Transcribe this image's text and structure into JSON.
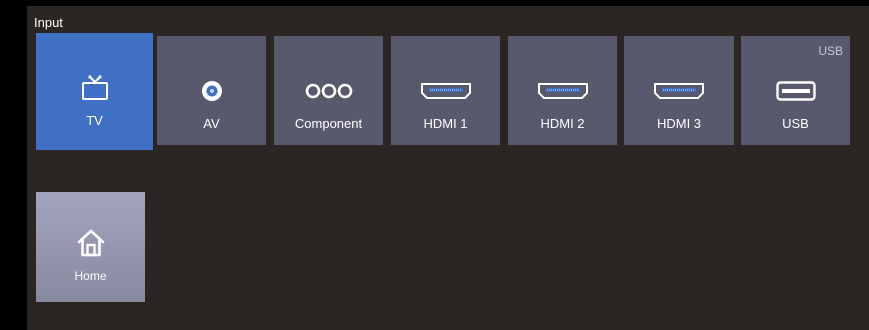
{
  "section_title": "Input",
  "inputs": [
    {
      "label": "TV",
      "icon": "tv-icon",
      "selected": true
    },
    {
      "label": "AV",
      "icon": "av-jack-icon"
    },
    {
      "label": "Component",
      "icon": "component-jacks-icon"
    },
    {
      "label": "HDMI 1",
      "icon": "hdmi-icon"
    },
    {
      "label": "HDMI 2",
      "icon": "hdmi-icon"
    },
    {
      "label": "HDMI 3",
      "icon": "hdmi-icon"
    },
    {
      "label": "USB",
      "icon": "usb-icon",
      "tag": "USB"
    }
  ],
  "home": {
    "label": "Home",
    "icon": "home-icon"
  },
  "colors": {
    "background": "#2b2523",
    "tile": "#59596e",
    "selected_tile": "#3f70c3",
    "home_tile": "#9596ad"
  }
}
